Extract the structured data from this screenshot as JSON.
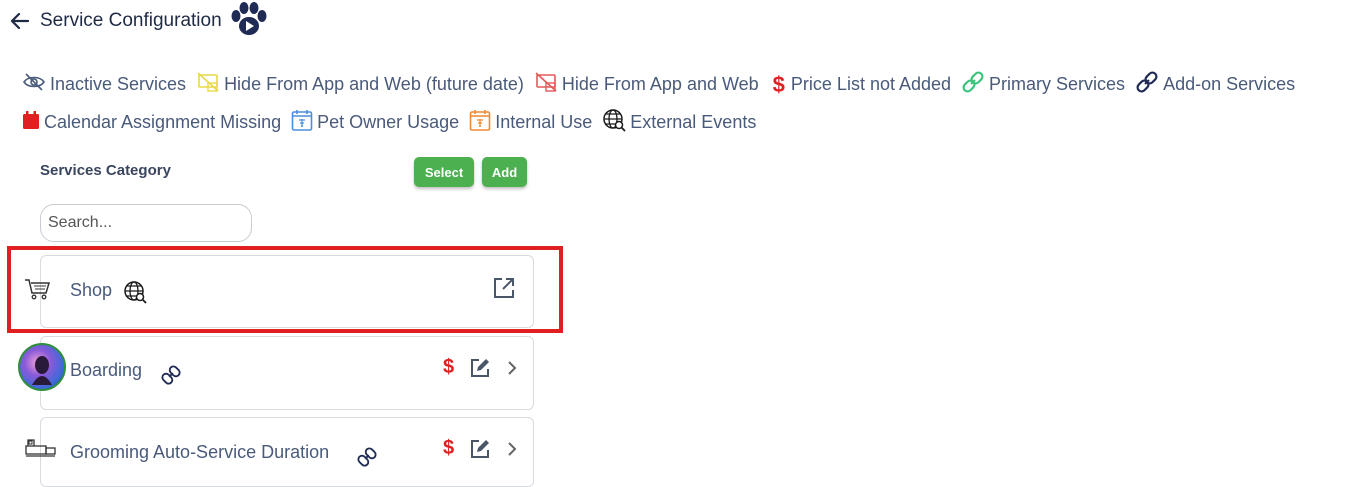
{
  "header": {
    "title": "Service Configuration"
  },
  "legend": {
    "inactive": "Inactive Services",
    "hide_future": "Hide From App and Web (future date)",
    "hide": "Hide From App and Web",
    "price_missing": "Price List not Added",
    "primary": "Primary Services",
    "addon": "Add-on Services",
    "calendar_missing": "Calendar Assignment Missing",
    "pet_owner": "Pet Owner Usage",
    "internal": "Internal Use",
    "external": "External Events"
  },
  "category": {
    "label": "Services Category",
    "select_label": "Select",
    "add_label": "Add",
    "search_placeholder": "Search..."
  },
  "services": [
    {
      "name": "Shop"
    },
    {
      "name": "Boarding"
    },
    {
      "name": "Grooming Auto-Service Duration"
    }
  ],
  "colors": {
    "accent_green": "#4caf50",
    "highlight_red": "#e02020",
    "price_red": "#e02020",
    "primary_link": "#3cc47c",
    "addon_link": "#1f2a55",
    "calendar_red": "#e02020",
    "pet_owner_blue": "#4a8fd9",
    "internal_orange": "#f08a30"
  }
}
